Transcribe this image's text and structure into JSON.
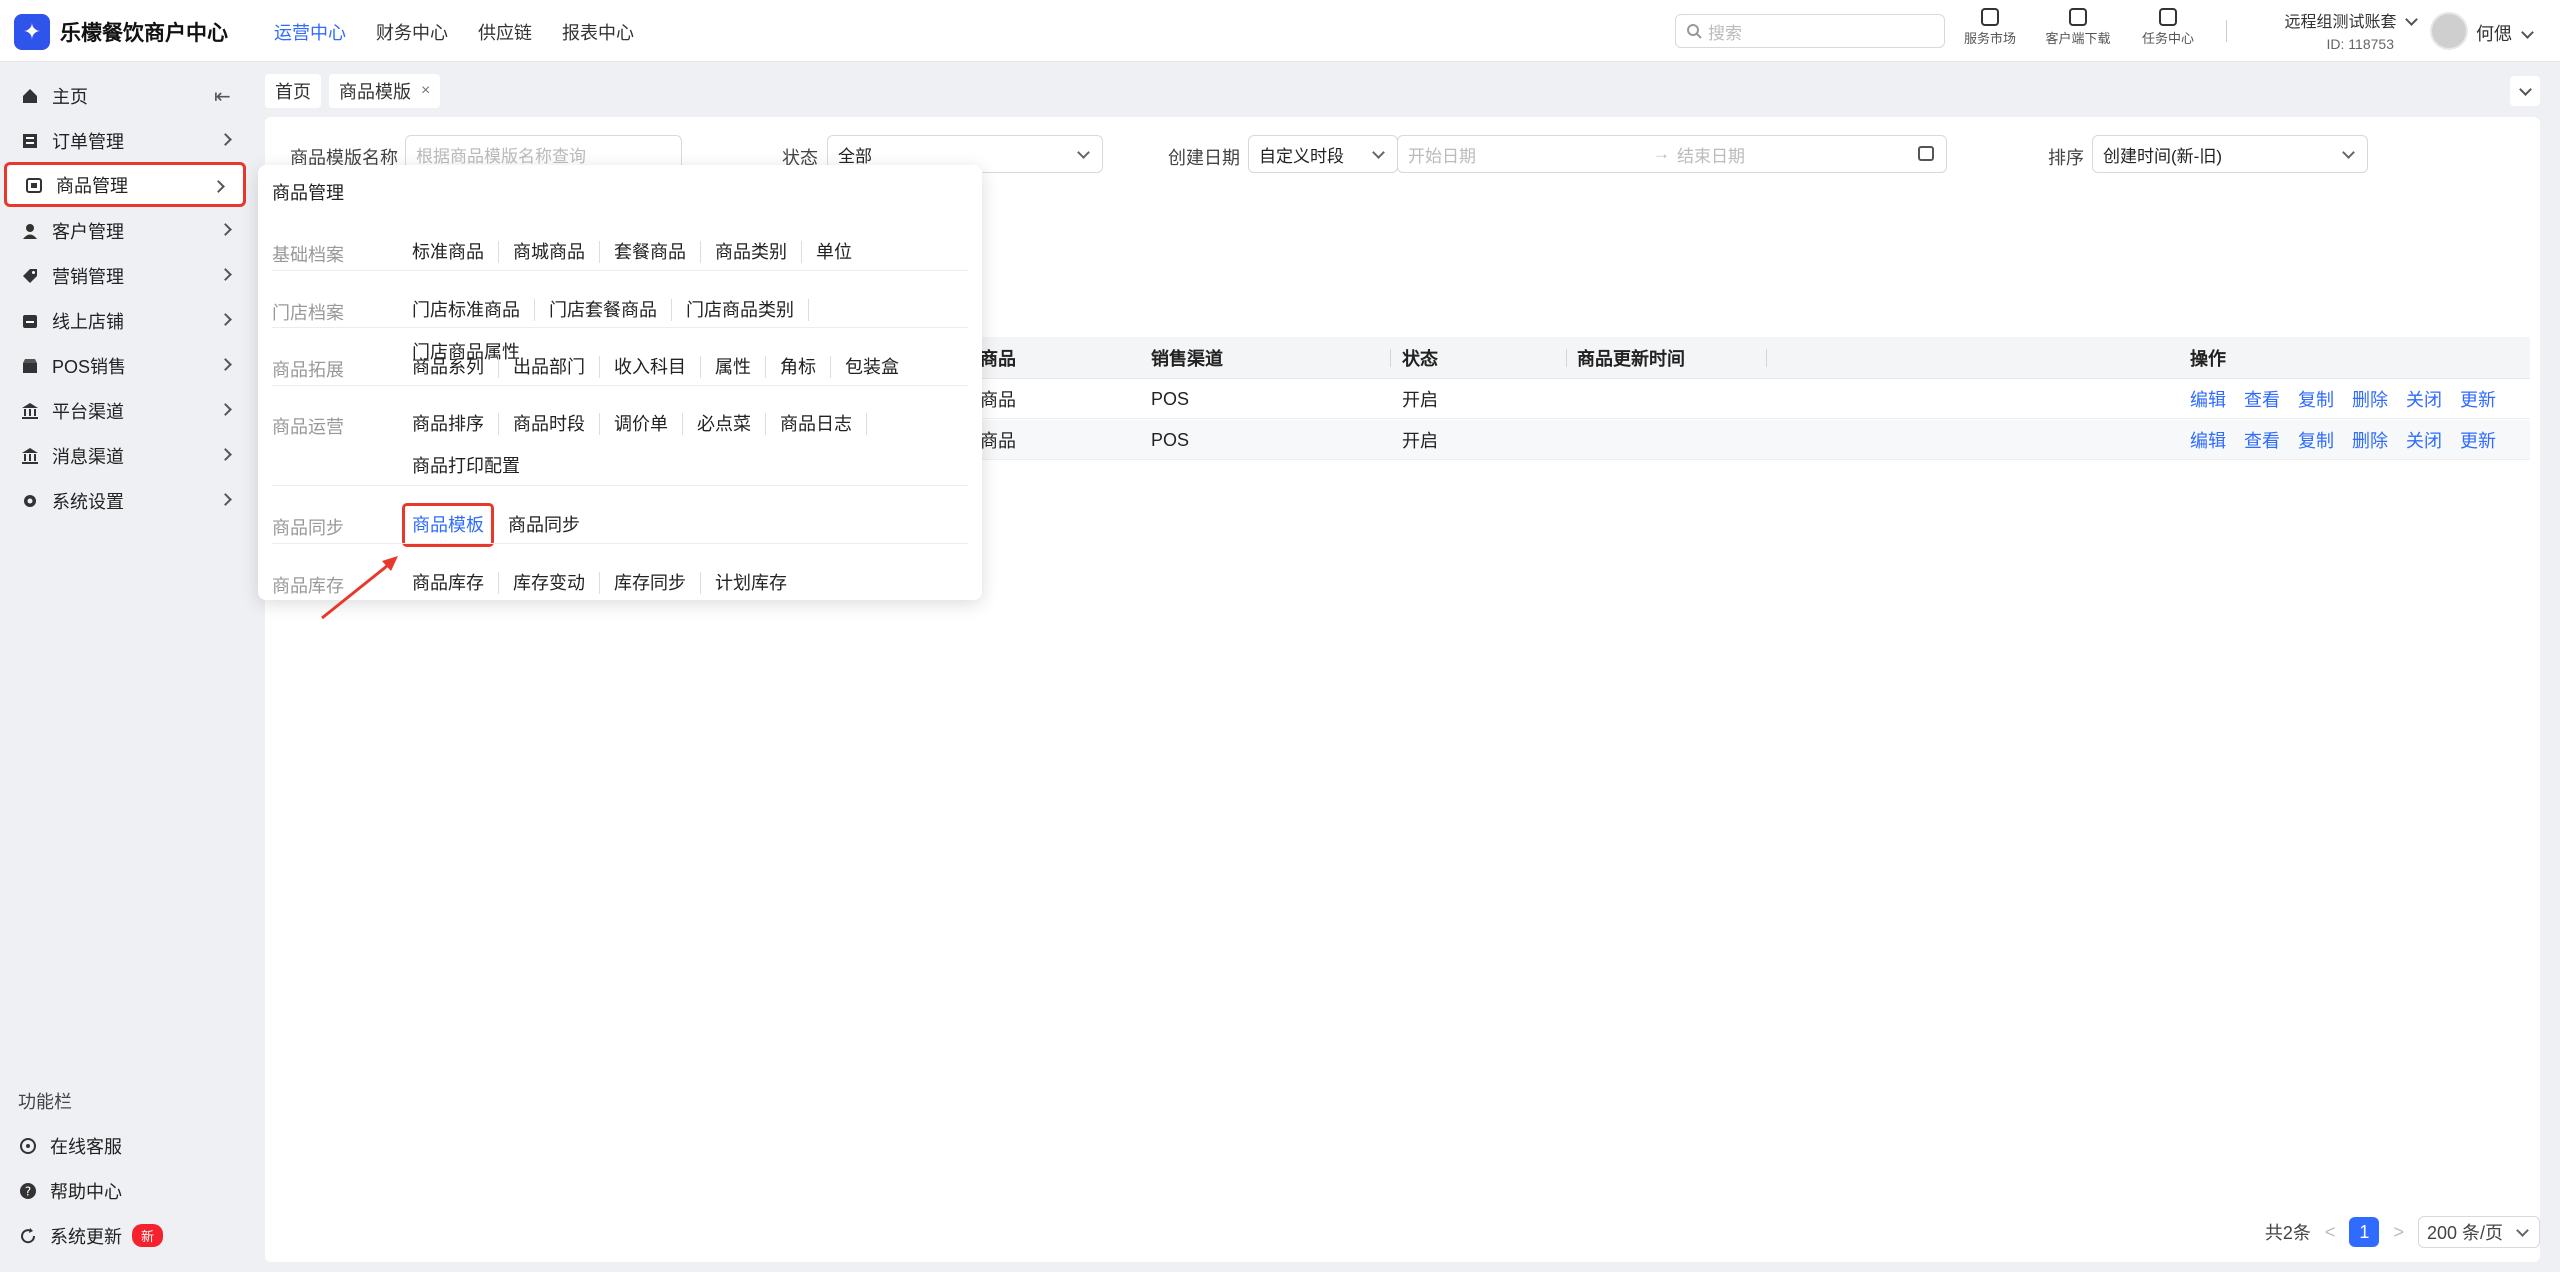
{
  "app": {
    "logo_char": "✦",
    "title": "乐檬餐饮商户中心"
  },
  "topnav": [
    "运营中心",
    "财务中心",
    "供应链",
    "报表中心"
  ],
  "search": {
    "placeholder": "搜索"
  },
  "tools": [
    "服务市场",
    "客户端下载",
    "任务中心"
  ],
  "account": {
    "name": "远程组测试账套",
    "id": "ID: 118753",
    "user": "何偲"
  },
  "sidebar": {
    "items": [
      {
        "label": "主页",
        "icon": "home-icon"
      },
      {
        "label": "订单管理",
        "icon": "order-icon"
      },
      {
        "label": "商品管理",
        "icon": "goods-icon"
      },
      {
        "label": "客户管理",
        "icon": "user-icon"
      },
      {
        "label": "营销管理",
        "icon": "tag-icon"
      },
      {
        "label": "线上店铺",
        "icon": "store-icon"
      },
      {
        "label": "POS销售",
        "icon": "pos-icon"
      },
      {
        "label": "平台渠道",
        "icon": "bank-icon"
      },
      {
        "label": "消息渠道",
        "icon": "bank-icon"
      },
      {
        "label": "系统设置",
        "icon": "gear-icon"
      }
    ],
    "func_title": "功能栏",
    "func_items": [
      {
        "label": "在线客服",
        "icon": "chat-icon"
      },
      {
        "label": "帮助中心",
        "icon": "help-icon"
      },
      {
        "label": "系统更新",
        "icon": "refresh-icon",
        "badge": "新"
      }
    ]
  },
  "tabs": [
    {
      "label": "首页"
    },
    {
      "label": "商品模版",
      "closable": "×"
    }
  ],
  "filters": {
    "name_label": "商品模版名称",
    "name_placeholder": "根据商品模版名称查询",
    "status_label": "状态",
    "status_value": "全部",
    "date_label": "创建日期",
    "date_mode": "自定义时段",
    "date_start": "开始日期",
    "date_arrow": "→",
    "date_end": "结束日期",
    "sort_label": "排序",
    "sort_value": "创建时间(新-旧)"
  },
  "table": {
    "headers": [
      "商品",
      "销售渠道",
      "状态",
      "商品更新时间",
      "操作"
    ],
    "rows": [
      {
        "goods": "商品",
        "channel": "POS",
        "status": "开启"
      },
      {
        "goods": "商品",
        "channel": "POS",
        "status": "开启"
      }
    ],
    "ops": [
      "编辑",
      "查看",
      "复制",
      "删除",
      "关闭",
      "更新"
    ]
  },
  "pager": {
    "total": "共2条",
    "prev": "<",
    "page": "1",
    "next": ">",
    "size": "200 条/页"
  },
  "flyout": {
    "title": "商品管理",
    "groups": [
      {
        "category": "基础档案",
        "links": [
          "标准商品",
          "商城商品",
          "套餐商品",
          "商品类别",
          "单位"
        ]
      },
      {
        "category": "门店档案",
        "links": [
          "门店标准商品",
          "门店套餐商品",
          "门店商品类别",
          "门店商品属性"
        ]
      },
      {
        "category": "商品拓展",
        "links": [
          "商品系列",
          "出品部门",
          "收入科目",
          "属性",
          "角标",
          "包装盒"
        ]
      },
      {
        "category": "商品运营",
        "links": [
          "商品排序",
          "商品时段",
          "调价单",
          "必点菜",
          "商品日志",
          "商品打印配置"
        ]
      },
      {
        "category": "商品同步",
        "links": [
          "商品模板",
          "商品同步"
        ]
      },
      {
        "category": "商品库存",
        "links": [
          "商品库存",
          "库存变动",
          "库存同步",
          "计划库存"
        ]
      }
    ]
  },
  "colors": {
    "accent": "#2f6bff",
    "highlight": "#e8382c",
    "brand": "#2f54eb"
  }
}
